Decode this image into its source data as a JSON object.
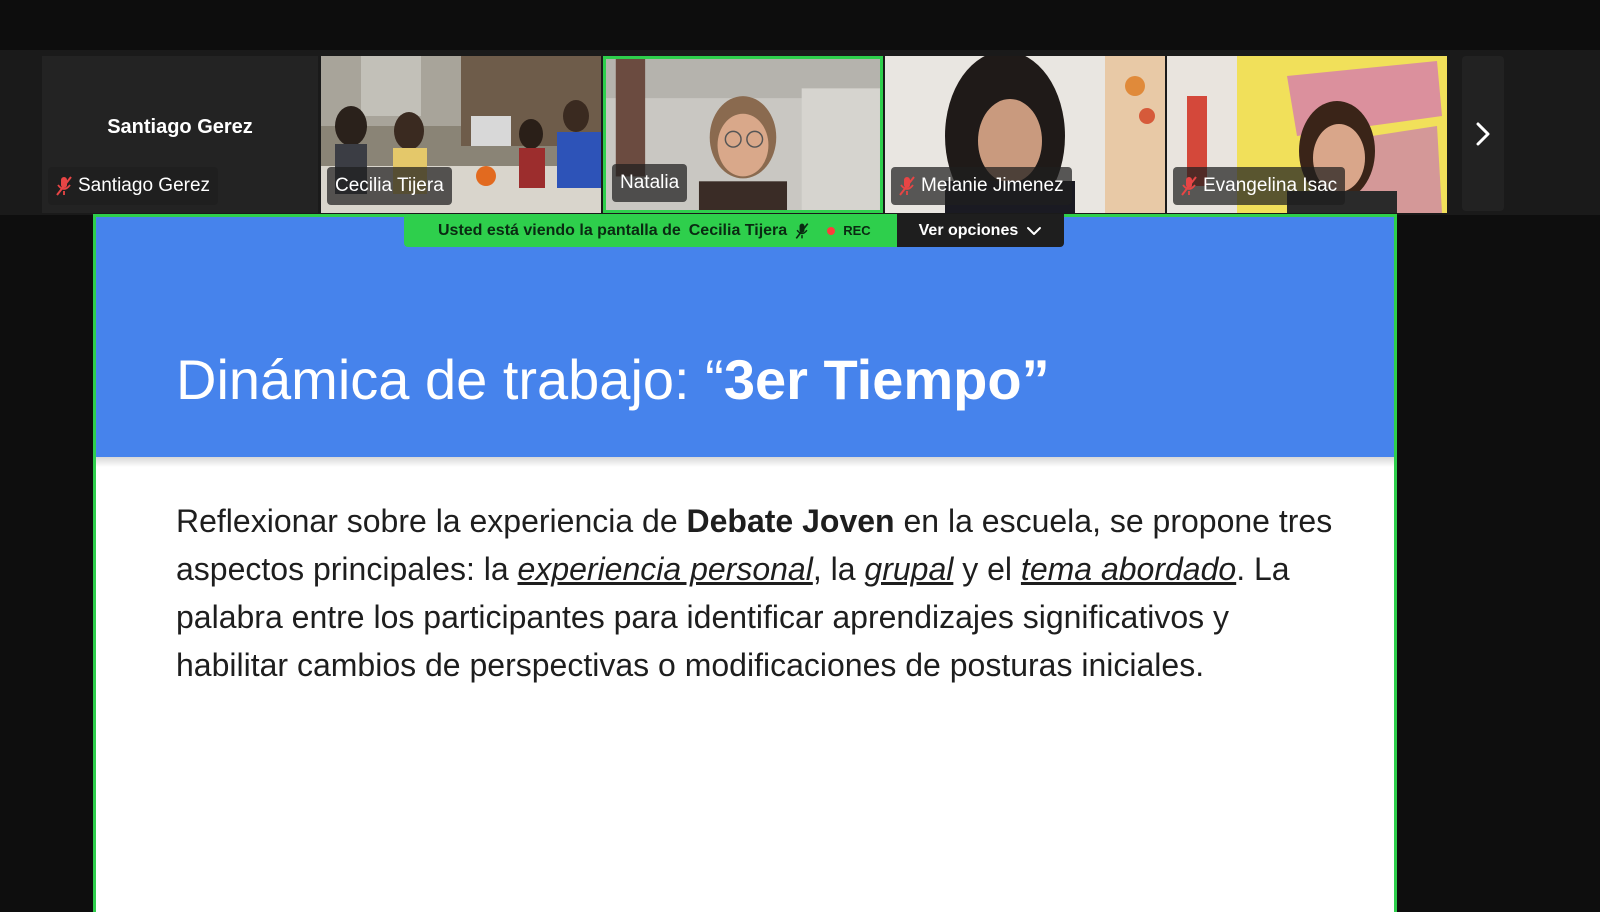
{
  "participants": [
    {
      "name": "Santiago Gerez",
      "display_name": "Santiago Gerez",
      "muted": true,
      "video": false
    },
    {
      "name": "Cecilia Tijera",
      "muted": false,
      "video": true
    },
    {
      "name": "Natalia",
      "muted": false,
      "video": true,
      "active_speaker": true
    },
    {
      "name": "Melanie Jimenez",
      "muted": true,
      "video": true
    },
    {
      "name": "Evangelina Isac",
      "muted": true,
      "video": true
    }
  ],
  "share_banner": {
    "text": "Usted está viendo la pantalla de",
    "presenter": "Cecilia Tijera",
    "rec_label": "REC",
    "options_label": "Ver opciones"
  },
  "slide": {
    "title_regular": "Dinámica de trabajo: “",
    "title_bold": "3er Tiempo",
    "title_close": "”",
    "body": {
      "p1": "Reflexionar sobre la experiencia de ",
      "bold1": "Debate Joven",
      "p2": " en la escuela, se propone tres aspectos principales: la ",
      "em1": "experiencia personal",
      "p3": ", la ",
      "em2": "grupal",
      "p4": " y el ",
      "em3": "tema abordado",
      "p5": ". La palabra entre los participantes para identificar aprendizajes significativos y habilitar cambios de perspectivas o modificaciones de posturas iniciales."
    }
  },
  "colors": {
    "accent_green": "#2ecf4c",
    "slide_header_blue": "#4683ec",
    "muted_red": "#e84545"
  },
  "icons": {
    "next": "chevron-right-icon",
    "mic_muted": "mic-muted-icon",
    "options": "chevron-down-icon"
  }
}
